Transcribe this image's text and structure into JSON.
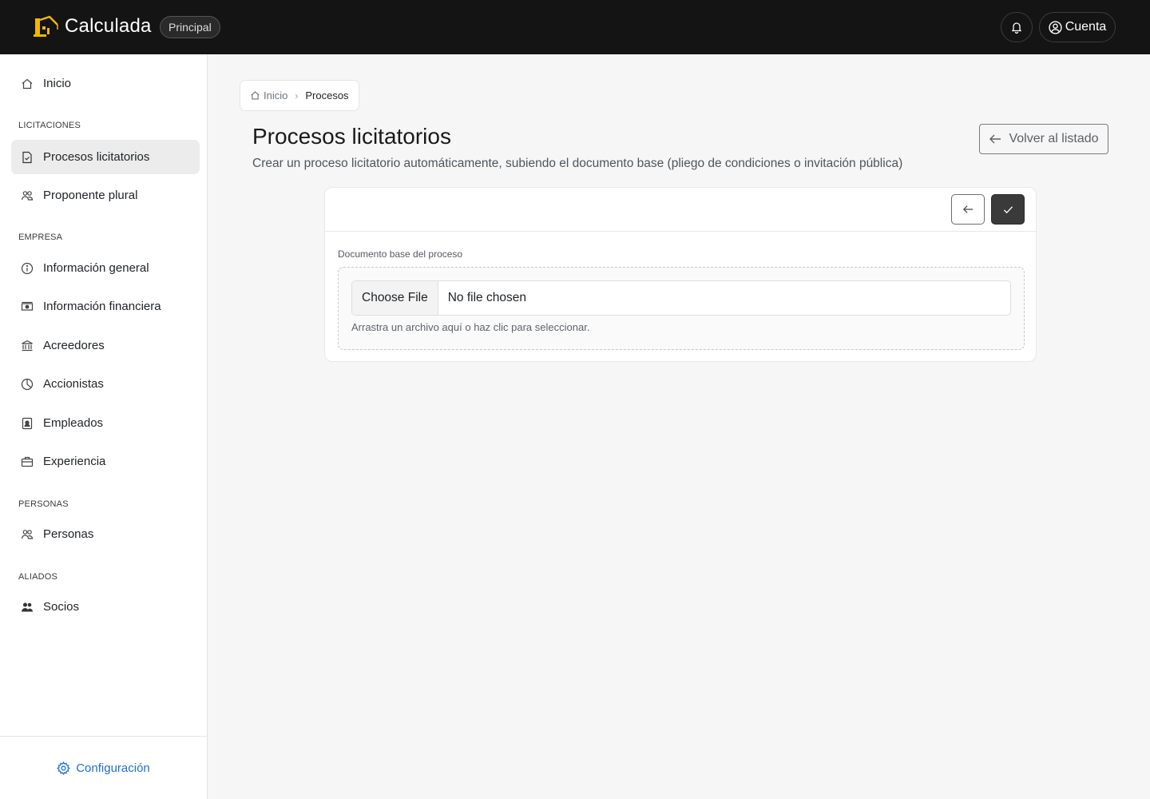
{
  "header": {
    "app_name": "Calculada",
    "env_badge": "Principal",
    "account_label": "Cuenta",
    "brand_color": "#f2b705"
  },
  "sidebar": {
    "home": "Inicio",
    "sections": [
      {
        "label": "LICITACIONES",
        "items": [
          "Procesos licitatorios",
          "Proponente plural"
        ]
      },
      {
        "label": "EMPRESA",
        "items": [
          "Información general",
          "Información financiera",
          "Acreedores",
          "Accionistas",
          "Empleados",
          "Experiencia"
        ]
      },
      {
        "label": "PERSONAS",
        "items": [
          "Personas"
        ]
      },
      {
        "label": "ALIADOS",
        "items": [
          "Socios"
        ]
      }
    ],
    "active_item": "Procesos licitatorios",
    "footer_link": "Configuración",
    "link_color": "#1f6fd1"
  },
  "breadcrumb": {
    "home": "Inicio",
    "current": "Procesos"
  },
  "page": {
    "title": "Procesos licitatorios",
    "subtitle": "Crear un proceso licitatorio automáticamente, subiendo el documento base (pliego de condiciones o invitación pública)",
    "back_button": "Volver al listado"
  },
  "form": {
    "field_label": "Documento base del proceso",
    "file_button": "Choose File",
    "file_status": "No file chosen",
    "hint": "Arrastra un archivo aquí o haz clic para seleccionar."
  }
}
